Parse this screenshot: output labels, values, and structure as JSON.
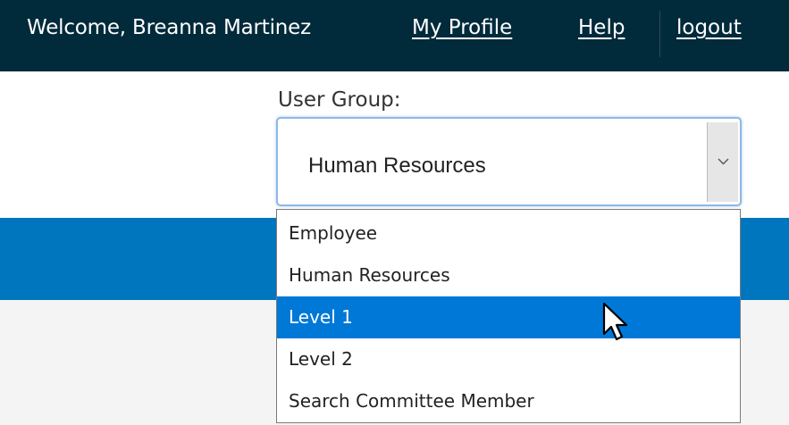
{
  "header": {
    "welcome_text": "Welcome, Breanna Martinez",
    "my_profile_label": "My Profile",
    "help_label": "Help",
    "logout_label": "logout"
  },
  "user_group": {
    "label": "User Group:",
    "selected_value": "Human Resources",
    "highlighted_option": "Level 1",
    "options": [
      "Employee",
      "Human Resources",
      "Level 1",
      "Level 2",
      "Search Committee Member"
    ]
  },
  "icons": {
    "dropdown_arrow": "chevron-down-icon",
    "cursor": "mouse-pointer-icon"
  },
  "colors": {
    "header_bg": "#012a3b",
    "band_blue": "#0076be",
    "highlight_blue": "#0078d7",
    "content_bg": "#f4f4f4"
  }
}
